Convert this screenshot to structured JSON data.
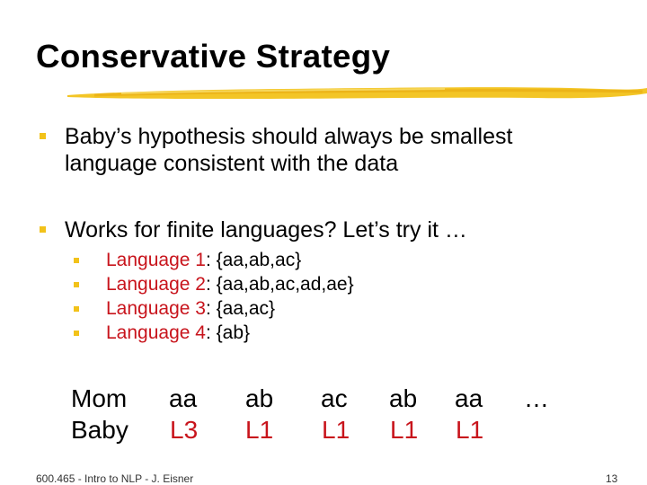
{
  "slide": {
    "title": "Conservative Strategy",
    "accent_color": "#f2c21a",
    "highlight_color": "#c8141c",
    "bullets": [
      {
        "lines": [
          "Baby’s hypothesis should always be smallest",
          "language consistent with the data"
        ]
      },
      {
        "lines": [
          "Works for finite languages?  Let’s try it …"
        ]
      }
    ],
    "languages": [
      {
        "label": "Language 1",
        "set": ": {aa,ab,ac}"
      },
      {
        "label": "Language 2",
        "set": ": {aa,ab,ac,ad,ae}"
      },
      {
        "label": "Language 3",
        "set": ": {aa,ac}"
      },
      {
        "label": "Language 4",
        "set": ": {ab}"
      }
    ],
    "sequence": {
      "mom_label": "Mom",
      "baby_label": "Baby",
      "mom": [
        "aa",
        "ab",
        "ac",
        "ab",
        "aa",
        "…"
      ],
      "baby": [
        "L3",
        "L1",
        "L1",
        "L1",
        "L1",
        ""
      ]
    },
    "footer": {
      "course": "600.465 - Intro to NLP - J. Eisner",
      "page_number": "13"
    }
  }
}
